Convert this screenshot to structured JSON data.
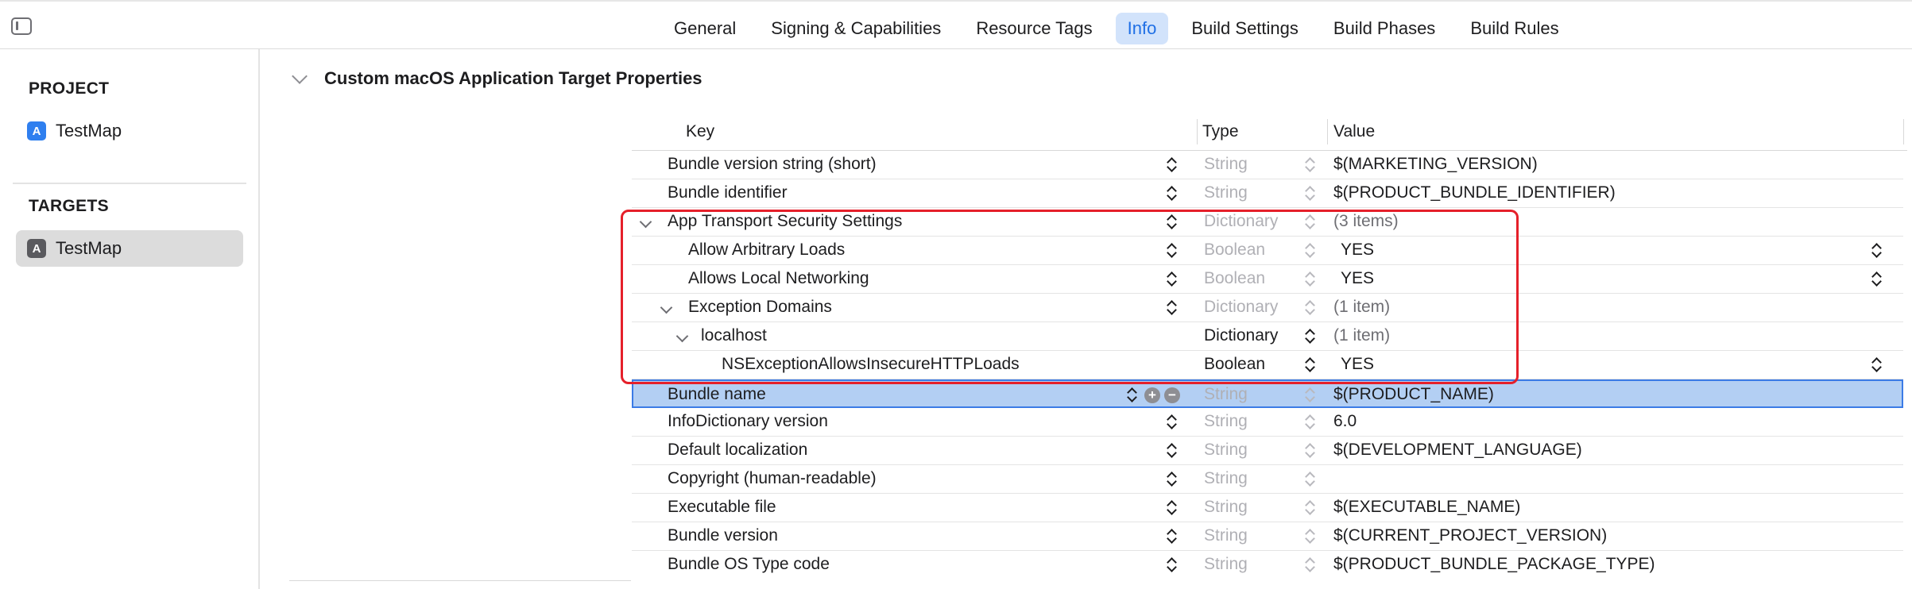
{
  "tabs": [
    "General",
    "Signing & Capabilities",
    "Resource Tags",
    "Info",
    "Build Settings",
    "Build Phases",
    "Build Rules"
  ],
  "active_tab": "Info",
  "sidebar": {
    "project_header": "PROJECT",
    "project_item": "TestMap",
    "targets_header": "TARGETS",
    "target_item": "TestMap"
  },
  "section_title": "Custom macOS Application Target Properties",
  "columns": {
    "key": "Key",
    "type": "Type",
    "value": "Value"
  },
  "rows": [
    {
      "key": "Bundle version string (short)",
      "type": "String",
      "value": "$(MARKETING_VERSION)"
    },
    {
      "key": "Bundle identifier",
      "type": "String",
      "value": "$(PRODUCT_BUNDLE_IDENTIFIER)"
    },
    {
      "key": "App Transport Security Settings",
      "type": "Dictionary",
      "value": "(3 items)"
    },
    {
      "key": "Allow Arbitrary Loads",
      "type": "Boolean",
      "value": "YES"
    },
    {
      "key": "Allows Local Networking",
      "type": "Boolean",
      "value": "YES"
    },
    {
      "key": "Exception Domains",
      "type": "Dictionary",
      "value": "(1 item)"
    },
    {
      "key": "localhost",
      "type": "Dictionary",
      "value": "(1 item)"
    },
    {
      "key": "NSExceptionAllowsInsecureHTTPLoads",
      "type": "Boolean",
      "value": "YES"
    },
    {
      "key": "Bundle name",
      "type": "String",
      "value": "$(PRODUCT_NAME)"
    },
    {
      "key": "InfoDictionary version",
      "type": "String",
      "value": "6.0"
    },
    {
      "key": "Default localization",
      "type": "String",
      "value": "$(DEVELOPMENT_LANGUAGE)"
    },
    {
      "key": "Copyright (human-readable)",
      "type": "String",
      "value": ""
    },
    {
      "key": "Executable file",
      "type": "String",
      "value": "$(EXECUTABLE_NAME)"
    },
    {
      "key": "Bundle version",
      "type": "String",
      "value": "$(CURRENT_PROJECT_VERSION)"
    },
    {
      "key": "Bundle OS Type code",
      "type": "String",
      "value": "$(PRODUCT_BUNDLE_PACKAGE_TYPE)"
    }
  ],
  "icons": {
    "sidebar_toggle": "sidebar-toggle-icon",
    "section_disclosure": "chevron-right-icon",
    "row_disclosure": "chevron-down-icon",
    "add": "plus-circle-icon",
    "remove": "minus-circle-icon",
    "stepper": "up-down-stepper-icon",
    "project": "app-project-icon",
    "target": "app-target-icon"
  },
  "colors": {
    "accent": "#1f6fe5",
    "active_tab_bg": "#d2e3fb",
    "selected_row_bg": "#b3cff3",
    "highlight_annotation": "#e5202a"
  },
  "selected_row": "Bundle name"
}
